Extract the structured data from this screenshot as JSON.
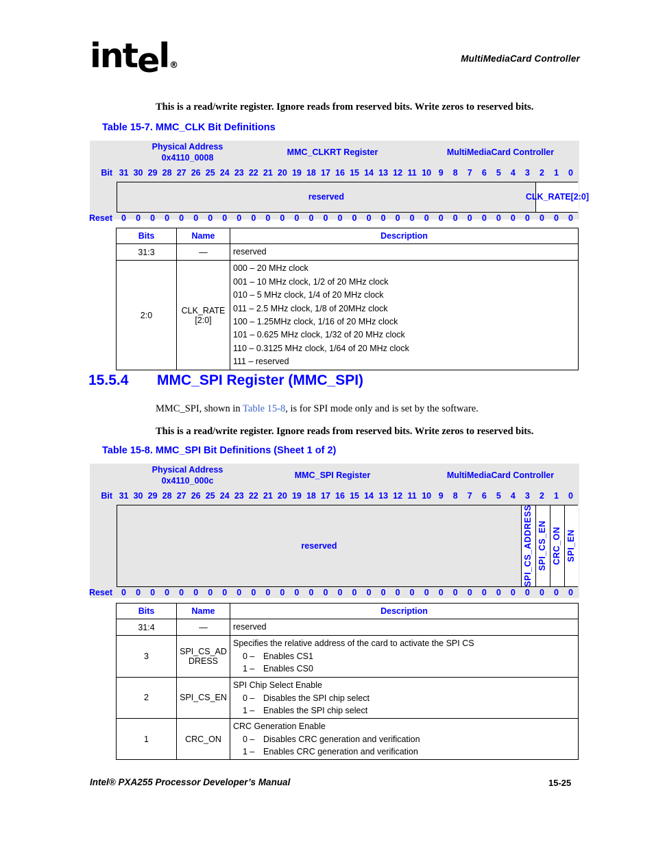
{
  "page": {
    "header_title": "MultiMediaCard Controller",
    "logo_text": "intel",
    "logo_registered": "®",
    "footer_left": "Intel® PXA255 Processor Developer’s Manual",
    "footer_page": "15-25"
  },
  "notes": {
    "clk_note": "This is a read/write register. Ignore reads from reserved bits. Write zeros to reserved bits.",
    "spi_note": "This is a read/write register. Ignore reads from reserved bits. Write zeros to reserved bits."
  },
  "captions": {
    "table_15_7": "Table 15-7. MMC_CLK Bit Definitions",
    "table_15_8": "Table 15-8. MMC_SPI Bit Definitions (Sheet 1 of 2)"
  },
  "section": {
    "number": "15.5.4",
    "title": "MMC_SPI Register (MMC_SPI)",
    "intro_pre": "MMC_SPI, shown in ",
    "intro_link": "Table 15-8",
    "intro_post": ", is for SPI mode only and is set by the software."
  },
  "clk_diagram": {
    "address_label": "Physical Address",
    "address_value": "0x4110_0008",
    "register_label": "MMC_CLKRT Register",
    "unit_label": "MultiMediaCard Controller",
    "bit_label": "Bit",
    "reset_label": "Reset",
    "bits": [
      "31",
      "30",
      "29",
      "28",
      "27",
      "26",
      "25",
      "24",
      "23",
      "22",
      "21",
      "20",
      "19",
      "18",
      "17",
      "16",
      "15",
      "14",
      "13",
      "12",
      "11",
      "10",
      "9",
      "8",
      "7",
      "6",
      "5",
      "4",
      "3",
      "2",
      "1",
      "0"
    ],
    "reset_values": [
      "0",
      "0",
      "0",
      "0",
      "0",
      "0",
      "0",
      "0",
      "0",
      "0",
      "0",
      "0",
      "0",
      "0",
      "0",
      "0",
      "0",
      "0",
      "0",
      "0",
      "0",
      "0",
      "0",
      "0",
      "0",
      "0",
      "0",
      "0",
      "0",
      "0",
      "0",
      "0"
    ],
    "fields": [
      {
        "name": "reserved",
        "span": 29,
        "style": "plain"
      },
      {
        "name": "CLK_RATE[2:0]",
        "span": 3,
        "style": "boxed"
      }
    ]
  },
  "clk_table": {
    "headers": [
      "Bits",
      "Name",
      "Description"
    ],
    "rows": [
      {
        "bits": "31:3",
        "name": "—",
        "desc_lines": [
          "reserved"
        ]
      },
      {
        "bits": "2:0",
        "name": "CLK_RATE[2:0]",
        "desc_lines": [
          "000 – 20 MHz clock",
          "001 – 10 MHz clock, 1/2 of 20 MHz clock",
          "010 – 5 MHz clock, 1/4 of 20 MHz clock",
          "011 – 2.5 MHz clock, 1/8 of 20MHz clock",
          "100 – 1.25MHz clock, 1/16 of 20 MHz clock",
          "101 – 0.625 MHz clock, 1/32 of 20 MHz clock",
          "110 – 0.3125 MHz clock, 1/64 of 20 MHz clock",
          "111 – reserved"
        ]
      }
    ]
  },
  "spi_diagram": {
    "address_label": "Physical Address",
    "address_value": "0x4110_000c",
    "register_label": "MMC_SPI Register",
    "unit_label": "MultiMediaCard Controller",
    "bit_label": "Bit",
    "reset_label": "Reset",
    "bits": [
      "31",
      "30",
      "29",
      "28",
      "27",
      "26",
      "25",
      "24",
      "23",
      "22",
      "21",
      "20",
      "19",
      "18",
      "17",
      "16",
      "15",
      "14",
      "13",
      "12",
      "11",
      "10",
      "9",
      "8",
      "7",
      "6",
      "5",
      "4",
      "3",
      "2",
      "1",
      "0"
    ],
    "reset_values": [
      "0",
      "0",
      "0",
      "0",
      "0",
      "0",
      "0",
      "0",
      "0",
      "0",
      "0",
      "0",
      "0",
      "0",
      "0",
      "0",
      "0",
      "0",
      "0",
      "0",
      "0",
      "0",
      "0",
      "0",
      "0",
      "0",
      "0",
      "0",
      "0",
      "0",
      "0",
      "0"
    ],
    "fields": [
      {
        "name": "reserved",
        "span": 28,
        "style": "plain"
      },
      {
        "name": "SPI_CS_ADDRESS",
        "span": 1,
        "style": "vertical"
      },
      {
        "name": "SPI_CS_EN",
        "span": 1,
        "style": "vertical"
      },
      {
        "name": "CRC_ON",
        "span": 1,
        "style": "vertical"
      },
      {
        "name": "SPI_EN",
        "span": 1,
        "style": "vertical"
      }
    ]
  },
  "spi_table": {
    "headers": [
      "Bits",
      "Name",
      "Description"
    ],
    "rows": [
      {
        "bits": "31:4",
        "name": "—",
        "desc_header": "reserved",
        "options": []
      },
      {
        "bits": "3",
        "name": "SPI_CS_ADDRESS",
        "desc_header": "Specifies the relative address of the card to activate the SPI CS",
        "options": [
          {
            "key": "0 –",
            "text": "Enables CS1"
          },
          {
            "key": "1 –",
            "text": "Enables CS0"
          }
        ]
      },
      {
        "bits": "2",
        "name": "SPI_CS_EN",
        "desc_header": "SPI Chip Select Enable",
        "options": [
          {
            "key": "0 –",
            "text": "Disables the SPI chip select"
          },
          {
            "key": "1 –",
            "text": "Enables the SPI chip select"
          }
        ]
      },
      {
        "bits": "1",
        "name": "CRC_ON",
        "desc_header": "CRC Generation Enable",
        "options": [
          {
            "key": "0 –",
            "text": "Disables CRC generation and verification"
          },
          {
            "key": "1 –",
            "text": "Enables CRC generation and verification"
          }
        ]
      }
    ]
  },
  "colors": {
    "accent_blue": "#0000ff",
    "diagram_bg": "#e6e6e6",
    "text_black": "#000000"
  }
}
